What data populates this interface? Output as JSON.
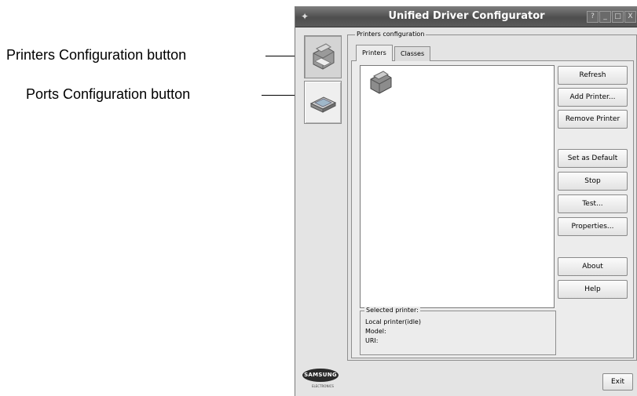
{
  "callouts": {
    "printers": "Printers Configuration button",
    "ports": "Ports Configuration button"
  },
  "window": {
    "title": "Unified Driver Configurator",
    "help_btn": "?",
    "min_btn": "_",
    "max_btn": "□",
    "close_btn": "X"
  },
  "nav": {
    "printers_icon": "printer-icon",
    "ports_icon": "scanner-port-icon"
  },
  "main": {
    "group_title": "Printers configuration",
    "tabs": [
      {
        "label": "Printers",
        "active": true
      },
      {
        "label": "Classes",
        "active": false
      }
    ],
    "actions": {
      "refresh": "Refresh",
      "add_printer": "Add Printer...",
      "remove_printer": "Remove Printer",
      "set_default": "Set as Default",
      "stop": "Stop",
      "test": "Test...",
      "properties": "Properties...",
      "about": "About",
      "help": "Help"
    },
    "selected_printer": {
      "title": "Selected printer:",
      "status": "Local printer(idle)",
      "model": "Model:",
      "uri": "URI:"
    }
  },
  "footer": {
    "exit": "Exit",
    "logo_brand": "SAMSUNG",
    "logo_sub": "ELECTRONICS"
  },
  "colors": {
    "callout_dot": "#1f7a80",
    "titlebar": "#5a5a5a",
    "window_bg": "#e4e4e4"
  }
}
